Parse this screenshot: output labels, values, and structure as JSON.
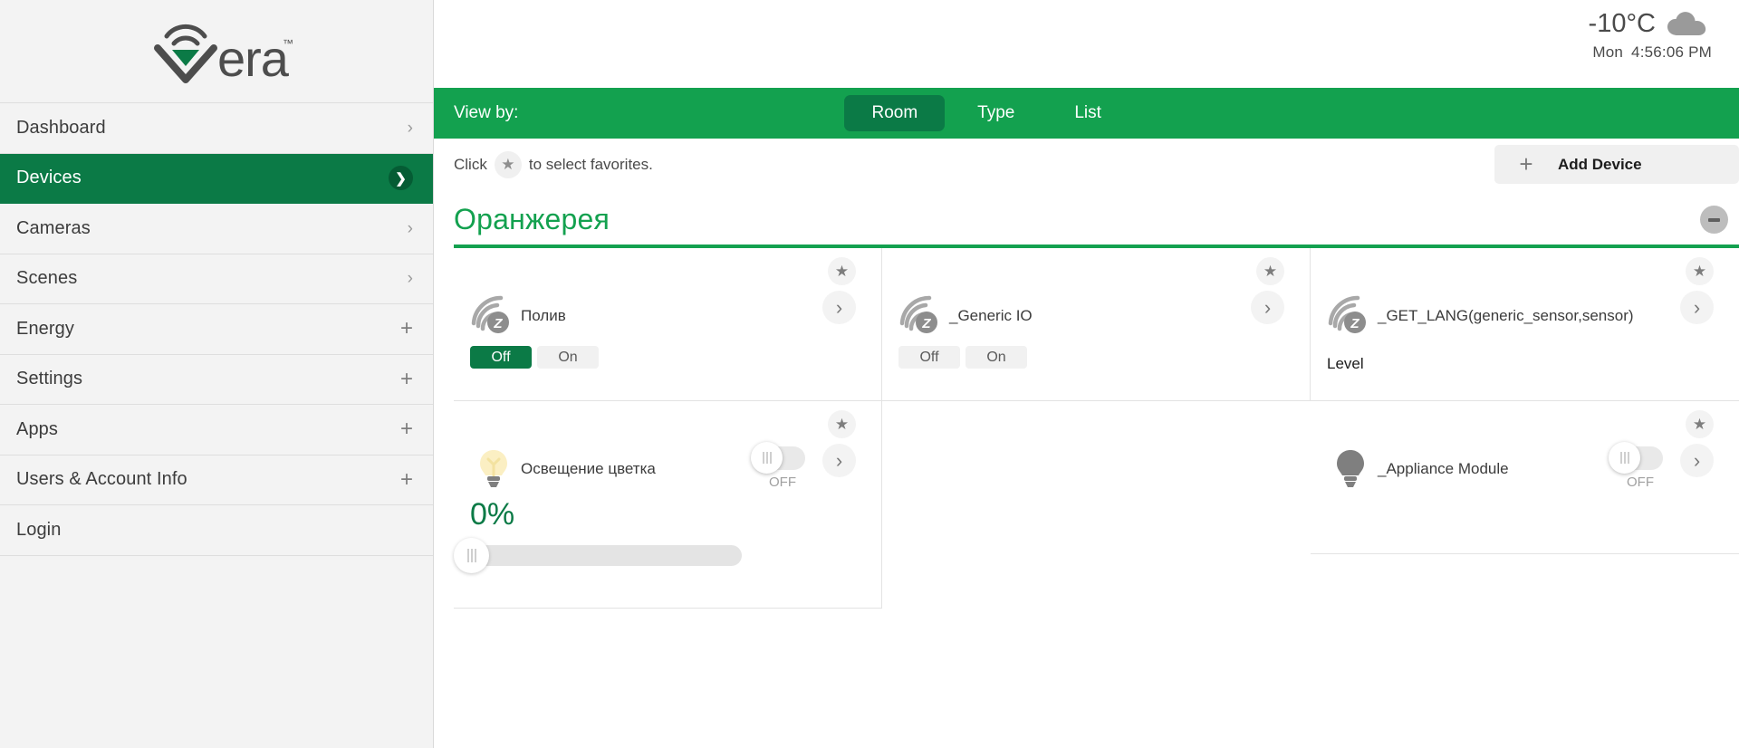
{
  "brand": {
    "name": "vera",
    "trademark": "™",
    "accent": "#13a14f",
    "dark_accent": "#0b7a46"
  },
  "sidebar": {
    "items": [
      {
        "label": "Dashboard",
        "affordance": "chevron",
        "active": false
      },
      {
        "label": "Devices",
        "affordance": "badge-chevron",
        "active": true
      },
      {
        "label": "Cameras",
        "affordance": "chevron",
        "active": false
      },
      {
        "label": "Scenes",
        "affordance": "chevron",
        "active": false
      },
      {
        "label": "Energy",
        "affordance": "plus",
        "active": false
      },
      {
        "label": "Settings",
        "affordance": "plus",
        "active": false
      },
      {
        "label": "Apps",
        "affordance": "plus",
        "active": false
      },
      {
        "label": "Users & Account Info",
        "affordance": "plus",
        "active": false
      },
      {
        "label": "Login",
        "affordance": "none",
        "active": false
      }
    ]
  },
  "topbar": {
    "temperature": "-10°C",
    "weather_icon": "cloud-icon",
    "day": "Mon",
    "time": "4:56:06 PM"
  },
  "viewbar": {
    "label": "View by:",
    "tabs": [
      {
        "label": "Room",
        "active": true
      },
      {
        "label": "Type",
        "active": false
      },
      {
        "label": "List",
        "active": false
      }
    ]
  },
  "tools": {
    "favorites_hint_prefix": "Click",
    "favorites_hint_suffix": "to select favorites.",
    "star_icon": "star-icon",
    "add_device_label": "Add Device",
    "add_device_plus": "+"
  },
  "room": {
    "title": "Оранжерея",
    "collapse_icon": "minus-icon"
  },
  "devices": [
    {
      "name": "Полив",
      "icon": "zwave-sensor-icon",
      "control": "onoff",
      "off_label": "Off",
      "on_label": "On",
      "selected": "Off"
    },
    {
      "name": "_Generic IO",
      "icon": "zwave-sensor-icon",
      "control": "onoff",
      "off_label": "Off",
      "on_label": "On",
      "selected": "none"
    },
    {
      "name": "_GET_LANG(generic_sensor,sensor)",
      "icon": "zwave-sensor-icon",
      "control": "level",
      "level_label": "Level"
    },
    {
      "name": "Освещение цветка",
      "icon": "lightbulb-on-icon",
      "control": "dimmer",
      "toggle_state": "OFF",
      "percent": "0%"
    },
    {
      "name": "_Appliance Module",
      "icon": "lightbulb-off-icon",
      "control": "toggle",
      "toggle_state": "OFF"
    }
  ]
}
